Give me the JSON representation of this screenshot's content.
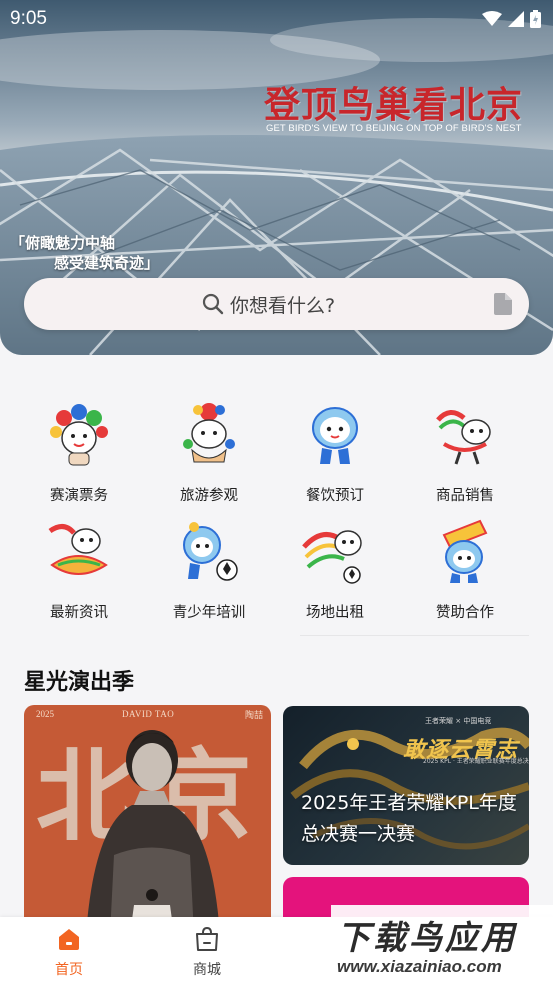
{
  "status_bar": {
    "time": "9:05"
  },
  "hero": {
    "title": "登顶鸟巢看北京",
    "subtitle": "GET BIRD'S VIEW TO BEIJING ON TOP OF BIRD'S NEST",
    "slogan_line1": "「俯瞰魅力中轴",
    "slogan_line2": "感受建筑奇迹」"
  },
  "search": {
    "placeholder": "你想看什么?"
  },
  "categories": [
    {
      "label": "赛演票务",
      "icon": "mascot-tickets-icon"
    },
    {
      "label": "旅游参观",
      "icon": "mascot-tour-icon"
    },
    {
      "label": "餐饮预订",
      "icon": "mascot-dining-icon"
    },
    {
      "label": "商品销售",
      "icon": "mascot-merch-icon"
    },
    {
      "label": "最新资讯",
      "icon": "mascot-news-icon"
    },
    {
      "label": "青少年培训",
      "icon": "mascot-training-icon"
    },
    {
      "label": "场地出租",
      "icon": "mascot-venue-icon"
    },
    {
      "label": "赞助合作",
      "icon": "mascot-sponsor-icon"
    }
  ],
  "section": {
    "title": "星光演出季"
  },
  "cards": {
    "concert": {
      "year": "2025",
      "artist": "DAVID TAO",
      "city": "陶喆",
      "big_text": "北京"
    },
    "kpl": {
      "brand": "王者荣耀 × 中国电竞",
      "slogan": "敢逐云霄志",
      "caption": "2025 KPL · 王者荣耀职业联赛年度总决赛",
      "title": "2025年王者荣耀KPL年度总决赛一决赛"
    }
  },
  "bottom_nav": [
    {
      "label": "首页",
      "active": true
    },
    {
      "label": "商城",
      "active": false
    }
  ],
  "watermark": {
    "line1": "下载鸟应用",
    "line2": "www.xiazainiao.com"
  },
  "colors": {
    "accent": "#f26522",
    "hero_title": "#c8262b",
    "pink_card": "#e4137c"
  }
}
